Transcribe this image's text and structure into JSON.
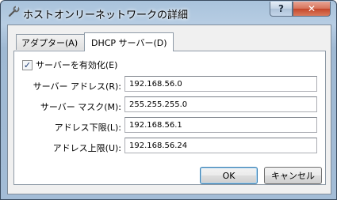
{
  "window": {
    "title": "ホストオンリーネットワークの詳細",
    "help_label": "?",
    "close_label": "✕"
  },
  "tabs": [
    {
      "label": "アダプター(A)",
      "active": false
    },
    {
      "label": "DHCP サーバー(D)",
      "active": true
    }
  ],
  "dhcp": {
    "enable_label": "サーバーを有効化(E)",
    "enabled": true,
    "fields": [
      {
        "label": "サーバー アドレス(R):",
        "value": "192.168.56.0"
      },
      {
        "label": "サーバー マスク(M):",
        "value": "255.255.255.0"
      },
      {
        "label": "アドレス下限(L):",
        "value": "192.168.56.1"
      },
      {
        "label": "アドレス上限(U):",
        "value": "192.168.56.24"
      }
    ]
  },
  "buttons": {
    "ok": "OK",
    "cancel": "キャンセル"
  }
}
